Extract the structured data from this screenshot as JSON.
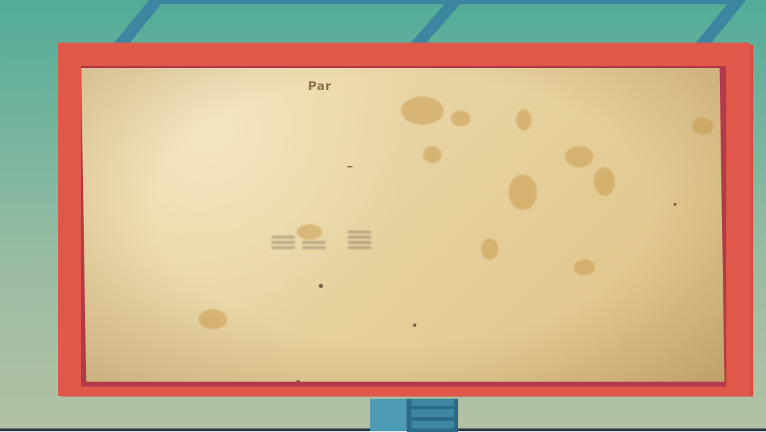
{
  "scene": {
    "sign_label": "Par",
    "colors": {
      "sky_top": "#52ac98",
      "sky_bottom": "#b4c1a4",
      "frame": "#e0584a",
      "frame_inner": "#b23b49",
      "parchment": "#e8d4a2",
      "stand": "#3e86a1"
    }
  }
}
